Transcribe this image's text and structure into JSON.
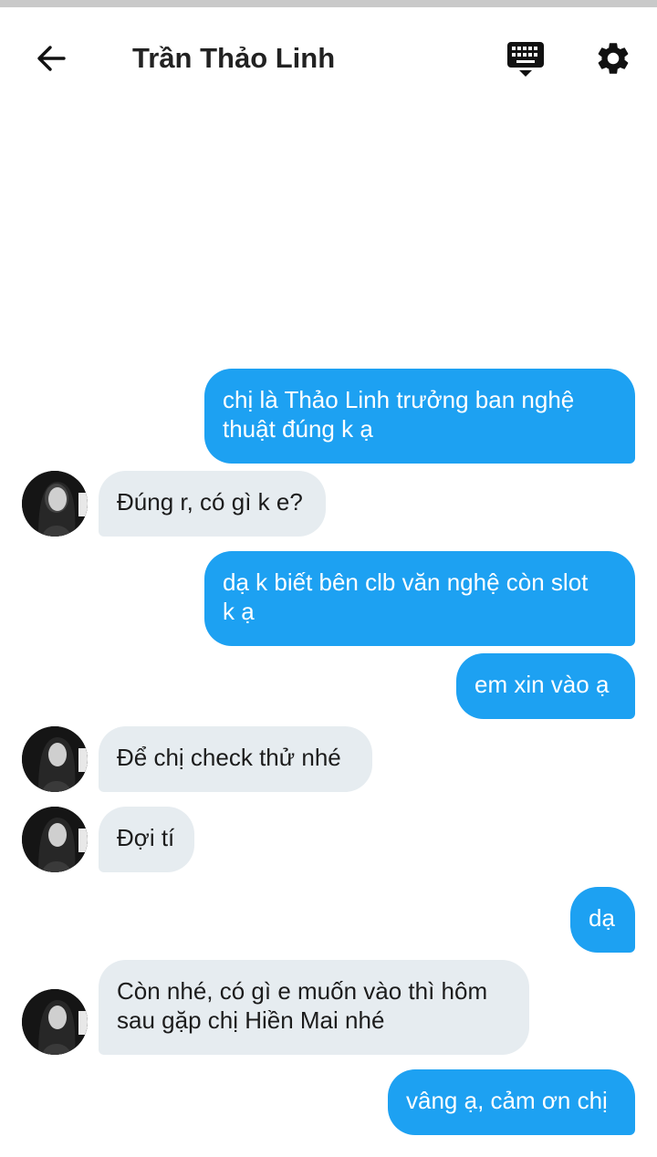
{
  "header": {
    "title": "Trần Thảo Linh",
    "back_icon": "arrow-left-icon",
    "keyboard_icon": "keyboard-icon",
    "settings_icon": "gear-icon"
  },
  "colors": {
    "outgoing_bubble": "#1da1f2",
    "incoming_bubble": "#e6ecf0"
  },
  "messages": [
    {
      "direction": "out",
      "lines": [
        "chị là Thảo Linh trưởng ban nghệ",
        "thuật đúng k ạ"
      ]
    },
    {
      "direction": "in",
      "lines": [
        "Đúng r, có gì k e?"
      ]
    },
    {
      "direction": "out",
      "lines": [
        "dạ k biết bên clb văn nghệ còn slot",
        "k ạ"
      ]
    },
    {
      "direction": "out",
      "lines": [
        "em xin vào ạ"
      ]
    },
    {
      "direction": "in",
      "lines": [
        "Để chị check thử nhé"
      ]
    },
    {
      "direction": "in",
      "lines": [
        "Đợi tí"
      ]
    },
    {
      "direction": "out",
      "lines": [
        "dạ"
      ]
    },
    {
      "direction": "in",
      "lines": [
        "Còn nhé, có gì e muốn vào thì hôm",
        "sau gặp chị Hiền Mai nhé"
      ]
    },
    {
      "direction": "out",
      "lines": [
        "vâng ạ, cảm ơn chị"
      ]
    }
  ]
}
